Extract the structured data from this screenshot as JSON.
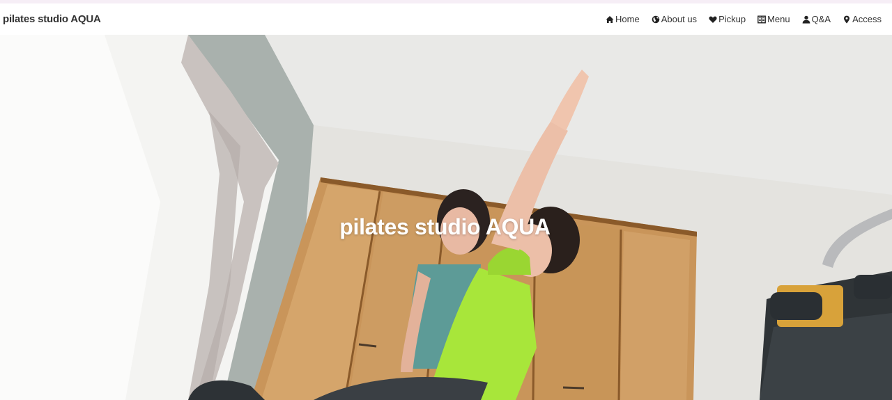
{
  "brand": {
    "title": "pilates studio AQUA"
  },
  "nav": {
    "items": [
      {
        "label": "Home",
        "icon": "home-icon"
      },
      {
        "label": "About us",
        "icon": "globe-icon"
      },
      {
        "label": "Pickup",
        "icon": "heart-icon"
      },
      {
        "label": "Menu",
        "icon": "book-icon"
      },
      {
        "label": "Q&A",
        "icon": "user-icon"
      },
      {
        "label": "Access",
        "icon": "map-marker-icon"
      }
    ]
  },
  "hero": {
    "title": "pilates studio AQUA",
    "image": "pilates-instructor-assisting-client-stretch-photo"
  },
  "colors": {
    "text": "#333333",
    "hero_text": "#ffffff",
    "top_line": "#f6eef6"
  }
}
